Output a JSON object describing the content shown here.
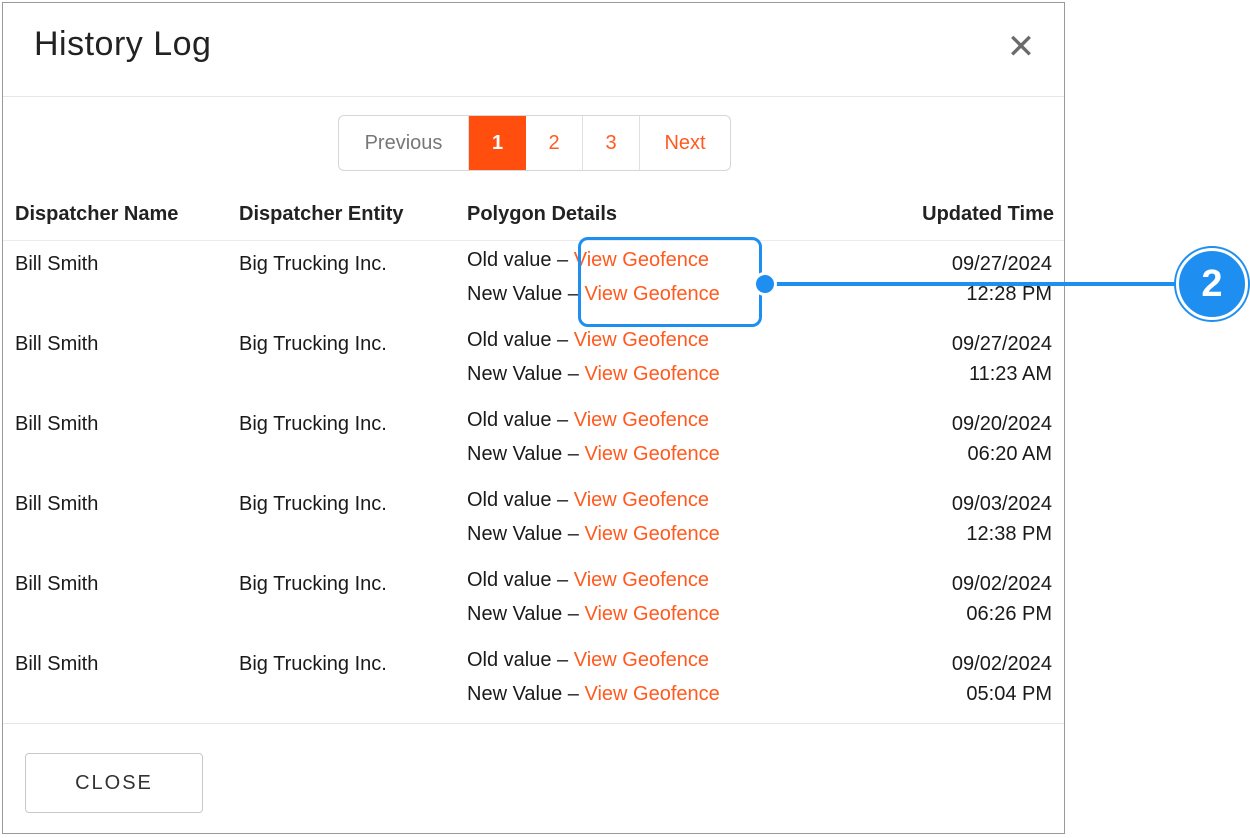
{
  "modal": {
    "title": "History Log",
    "close_icon": "close-icon",
    "close_button_label": "CLOSE"
  },
  "pagination": {
    "previous_label": "Previous",
    "pages": [
      "1",
      "2",
      "3"
    ],
    "active_page": "1",
    "next_label": "Next"
  },
  "table": {
    "headers": {
      "dispatcher_name": "Dispatcher Name",
      "dispatcher_entity": "Dispatcher Entity",
      "polygon_details": "Polygon Details",
      "updated_time": "Updated Time"
    },
    "old_label": "Old value –",
    "new_label": "New Value –",
    "link_label": "View Geofence",
    "rows": [
      {
        "name": "Bill Smith",
        "entity": "Big Trucking Inc.",
        "date": "09/27/2024",
        "time": "12:28 PM"
      },
      {
        "name": "Bill Smith",
        "entity": "Big Trucking Inc.",
        "date": "09/27/2024",
        "time": "11:23 AM"
      },
      {
        "name": "Bill Smith",
        "entity": "Big Trucking Inc.",
        "date": "09/20/2024",
        "time": "06:20 AM"
      },
      {
        "name": "Bill Smith",
        "entity": "Big Trucking Inc.",
        "date": "09/03/2024",
        "time": "12:38 PM"
      },
      {
        "name": "Bill Smith",
        "entity": "Big Trucking Inc.",
        "date": "09/02/2024",
        "time": "06:26 PM"
      },
      {
        "name": "Bill Smith",
        "entity": "Big Trucking Inc.",
        "date": "09/02/2024",
        "time": "05:04 PM"
      }
    ]
  },
  "callout": {
    "number": "2"
  },
  "colors": {
    "accent": "#ff4e0e",
    "link": "#ff5a1f",
    "callout": "#1e8ff0"
  }
}
